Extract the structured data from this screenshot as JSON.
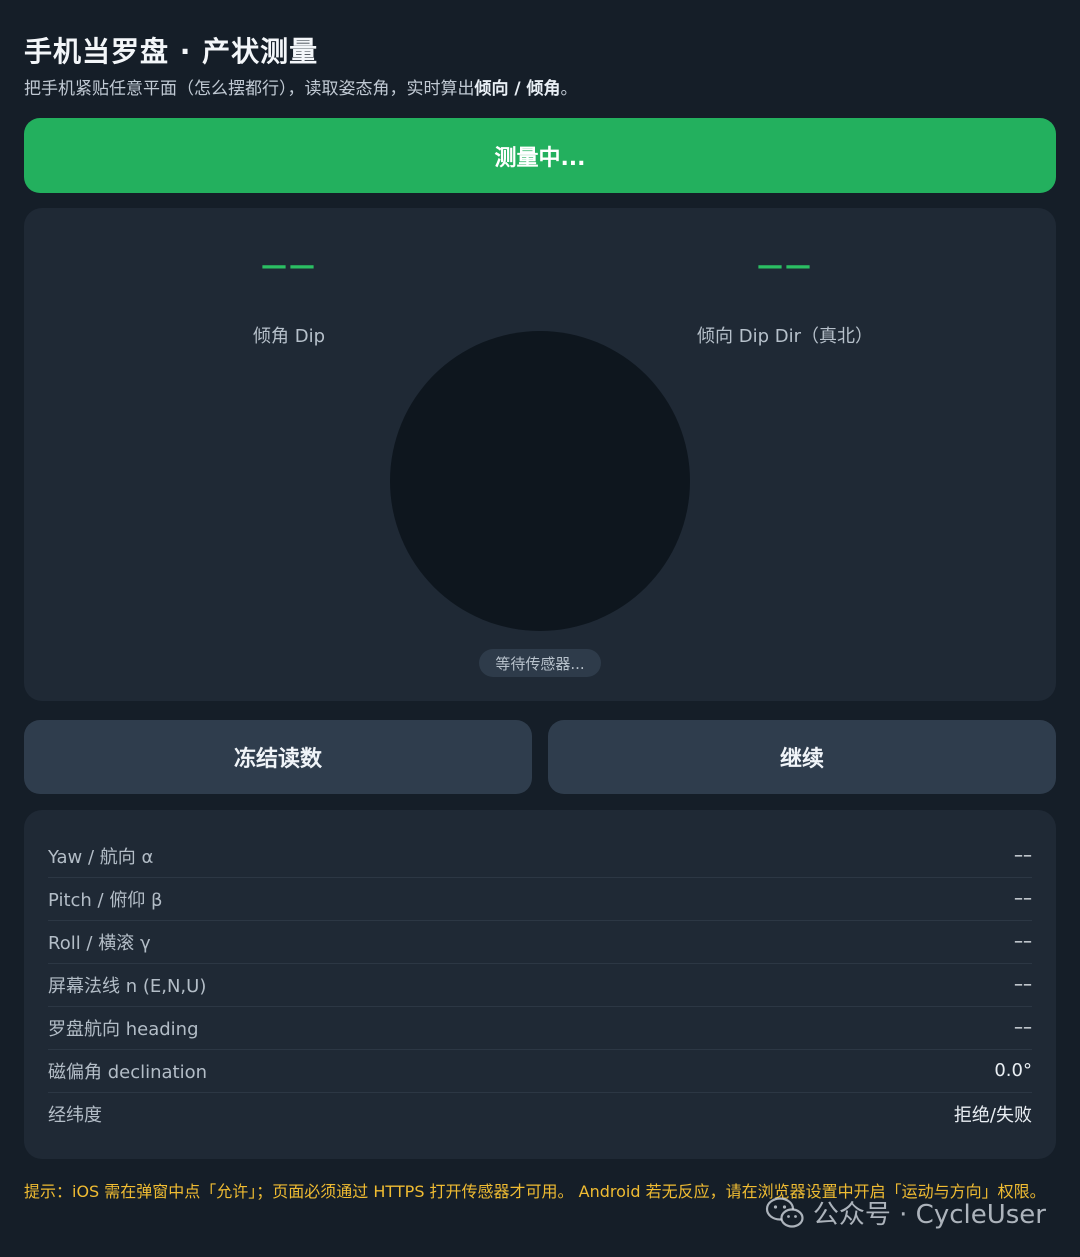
{
  "header": {
    "title": "手机当罗盘 · 产状测量",
    "subtitle_prefix": "把手机紧贴任意平面（怎么摆都行），读取姿态角，实时算出",
    "subtitle_emph1": "倾向",
    "subtitle_sep": " / ",
    "subtitle_emph2": "倾角",
    "subtitle_suffix": "。"
  },
  "measure_button": {
    "label": "测量中..."
  },
  "gauge": {
    "dip_value": "——",
    "dip_label": "倾角 Dip",
    "dip_dir_value": "——",
    "dip_dir_label": "倾向 Dip Dir（真北）",
    "sensor_status": "等待传感器..."
  },
  "actions": {
    "freeze_label": "冻结读数",
    "continue_label": "继续"
  },
  "readings": [
    {
      "label": "Yaw / 航向 α",
      "value": "––"
    },
    {
      "label": "Pitch / 俯仰 β",
      "value": "––"
    },
    {
      "label": "Roll / 横滚 γ",
      "value": "––"
    },
    {
      "label": "屏幕法线 n (E,N,U)",
      "value": "––"
    },
    {
      "label": "罗盘航向 heading",
      "value": "––"
    },
    {
      "label": "磁偏角 declination",
      "value": "0.0°"
    },
    {
      "label": "经纬度",
      "value": "拒绝/失败"
    }
  ],
  "tip": {
    "text": "提示：iOS 需在弹窗中点「允许」；页面必须通过 HTTPS 打开传感器才可用。 Android 若无反应，请在浏览器设置中开启「运动与方向」权限。"
  },
  "watermark": {
    "text": "公众号 · CycleUser"
  },
  "colors": {
    "background": "#151e28",
    "card": "#1f2935",
    "accent_green": "#23b05e",
    "tip_yellow": "#f0bc32"
  },
  "icons": {
    "watermark_icon": "wechat-icon"
  }
}
